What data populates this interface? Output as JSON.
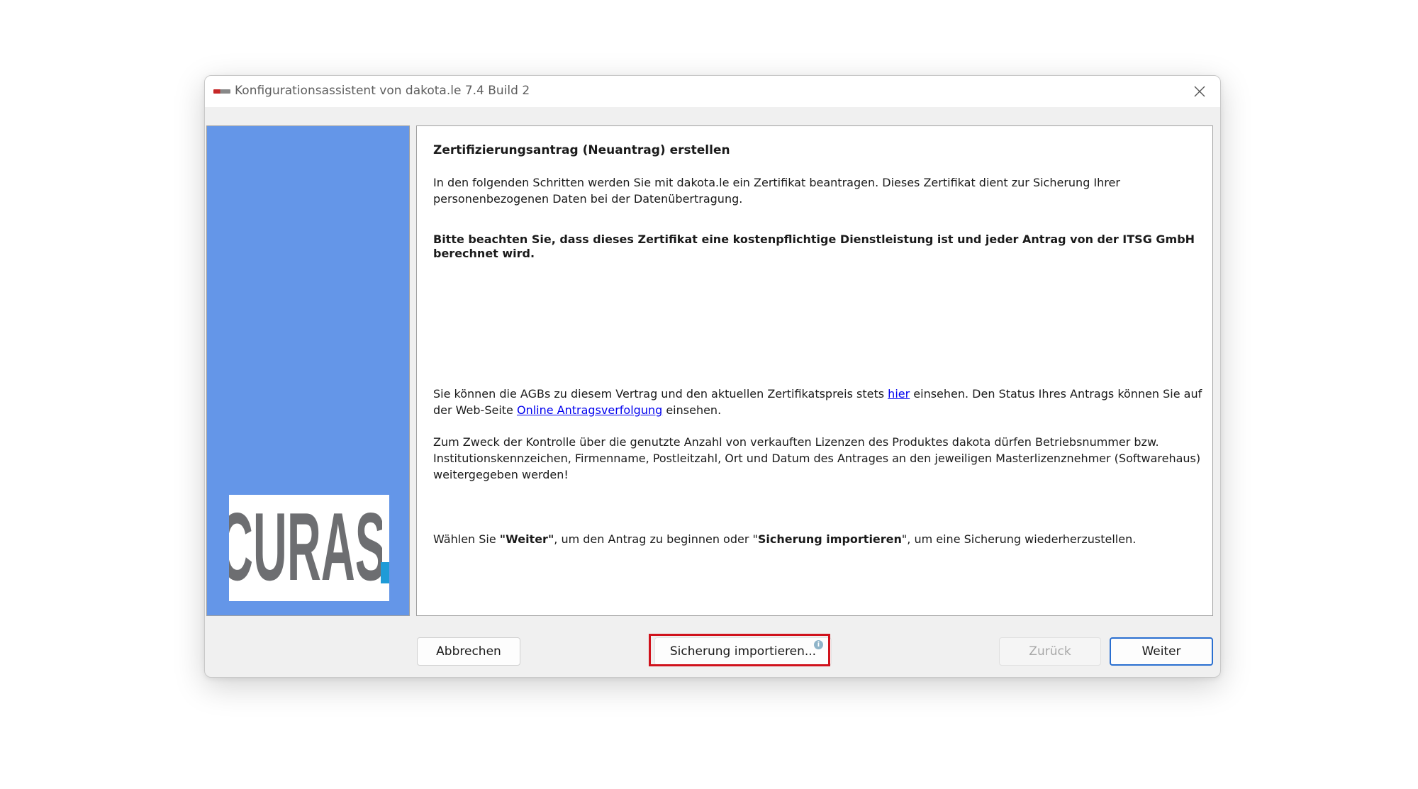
{
  "window": {
    "title": "Konfigurationsassistent von dakota.le 7.4 Build 2"
  },
  "sidebar": {
    "logo_text": "CURAS"
  },
  "content": {
    "heading": "Zertifizierungsantrag (Neuantrag) erstellen",
    "intro": "In den folgenden Schritten werden Sie mit dakota.le ein Zertifikat beantragen. Dieses Zertifikat dient zur Sicherung Ihrer personenbezogenen Daten bei der Datenübertragung.",
    "notice": "Bitte beachten Sie, dass dieses Zertifikat eine kostenpflichtige Dienstleistung ist und jeder Antrag von der ITSG GmbH berechnet wird.",
    "agb": {
      "part1": "Sie können die AGBs zu diesem Vertrag und den aktuellen Zertifikatspreis stets ",
      "link1": "hier",
      "part2": " einsehen. Den Status Ihres Antrags können Sie auf der Web-Seite ",
      "link2": "Online Antragsverfolgung",
      "part3": " einsehen."
    },
    "control": "Zum Zweck der Kontrolle über die genutzte Anzahl von verkauften Lizenzen des Produktes dakota dürfen Betriebsnummer bzw. Institutionskennzeichen, Firmenname, Postleitzahl, Ort und Datum des Antrages an den jeweiligen Masterlizenznehmer (Softwarehaus) weitergegeben werden!",
    "choice": {
      "part1": "Wählen Sie ",
      "bold1": "\"Weiter\"",
      "part2": ", um den Antrag zu beginnen oder \"",
      "bold2": "Sicherung importieren",
      "part3": "\", um eine Sicherung wiederherzustellen."
    }
  },
  "buttons": {
    "cancel": "Abbrechen",
    "import": "Sicherung importieren...",
    "back": "Zurück",
    "next": "Weiter"
  },
  "icons": {
    "close": "close-icon",
    "info": "info-icon",
    "app": "dakota-app-icon"
  },
  "colors": {
    "sidebar": "#6496e8",
    "highlight": "#d0121c",
    "link": "#0000ee",
    "logo_gray": "#6d6e71",
    "logo_blue": "#1e9bd7",
    "default_button_border": "#2a6fd0"
  }
}
